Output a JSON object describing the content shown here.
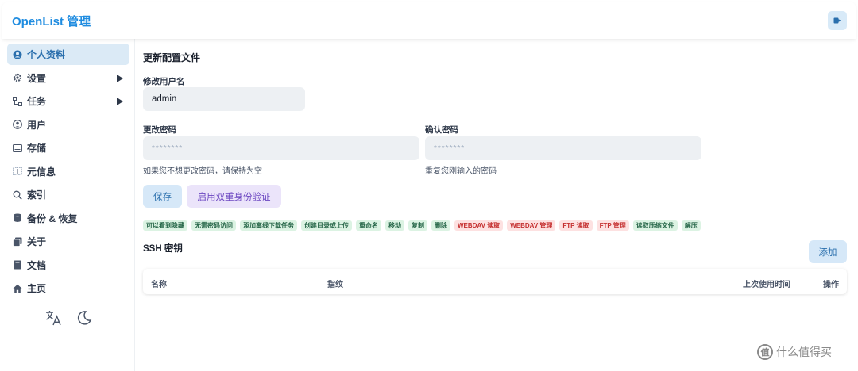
{
  "header": {
    "brand": "OpenList 管理"
  },
  "sidebar": {
    "items": [
      {
        "label": "个人资料",
        "icon": "user-circle-icon",
        "active": true
      },
      {
        "label": "设置",
        "icon": "gear-icon",
        "has_arrow": true
      },
      {
        "label": "任务",
        "icon": "tasks-icon",
        "has_arrow": true
      },
      {
        "label": "用户",
        "icon": "user-icon"
      },
      {
        "label": "存储",
        "icon": "storage-icon"
      },
      {
        "label": "元信息",
        "icon": "meta-icon"
      },
      {
        "label": "索引",
        "icon": "search-icon"
      },
      {
        "label": "备份 & 恢复",
        "icon": "database-icon"
      },
      {
        "label": "关于",
        "icon": "copy-icon"
      },
      {
        "label": "文档",
        "icon": "book-icon"
      },
      {
        "label": "主页",
        "icon": "home-icon"
      }
    ]
  },
  "main": {
    "title": "更新配置文件",
    "username_label": "修改用户名",
    "username_value": "admin",
    "password_label": "更改密码",
    "password_placeholder": "********",
    "password_help": "如果您不想更改密码，请保持为空",
    "confirm_label": "确认密码",
    "confirm_placeholder": "********",
    "confirm_help": "重复您刚输入的密码",
    "save_label": "保存",
    "twofa_label": "启用双重身份验证",
    "permissions": [
      {
        "label": "可以看到隐藏",
        "status": "green"
      },
      {
        "label": "无需密码访问",
        "status": "green"
      },
      {
        "label": "添加离线下载任务",
        "status": "green"
      },
      {
        "label": "创建目录或上传",
        "status": "green"
      },
      {
        "label": "重命名",
        "status": "green"
      },
      {
        "label": "移动",
        "status": "green"
      },
      {
        "label": "复制",
        "status": "green"
      },
      {
        "label": "删除",
        "status": "green"
      },
      {
        "label": "WEBDAV 读取",
        "status": "red"
      },
      {
        "label": "WEBDAV 管理",
        "status": "red"
      },
      {
        "label": "FTP 读取",
        "status": "red"
      },
      {
        "label": "FTP 管理",
        "status": "red"
      },
      {
        "label": "读取压缩文件",
        "status": "green"
      },
      {
        "label": "解压",
        "status": "green"
      }
    ],
    "ssh": {
      "title": "SSH 密钥",
      "add_label": "添加",
      "columns": [
        "名称",
        "指纹",
        "上次使用时间",
        "操作"
      ]
    }
  },
  "watermark": {
    "text": "什么值得买",
    "logo": "值"
  },
  "colors": {
    "accent": "#1f8ce0",
    "active_bg": "#dbeaf6",
    "tag_green": "#dcf3e3",
    "tag_red": "#fde1e1"
  }
}
